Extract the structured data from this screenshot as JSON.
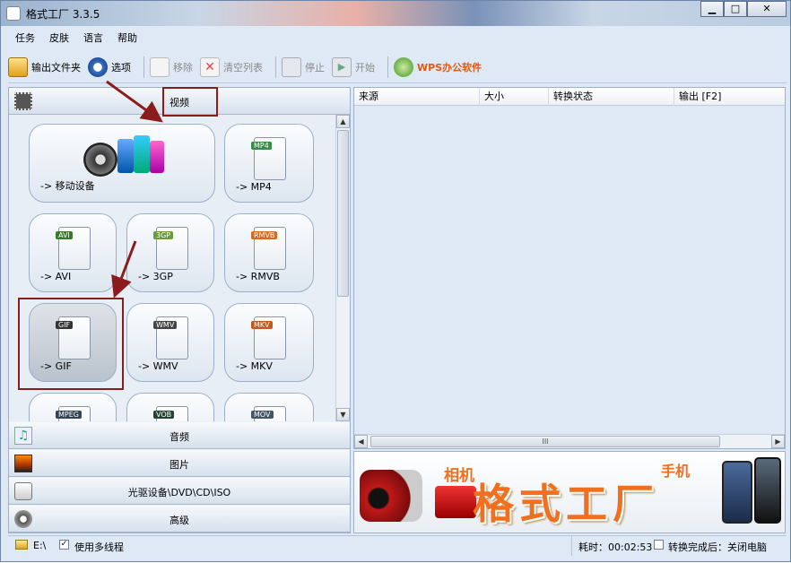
{
  "window": {
    "title": "格式工厂 3.3.5",
    "min_label": "▭",
    "max_label": "□",
    "close_label": "✕"
  },
  "menu": [
    "任务",
    "皮肤",
    "语言",
    "帮助"
  ],
  "toolbar": {
    "output_folder": "输出文件夹",
    "options": "选项",
    "remove": "移除",
    "clear_list": "清空列表",
    "stop": "停止",
    "start": "开始",
    "wps": "WPS办公软件"
  },
  "categories": {
    "video": "视频",
    "audio": "音频",
    "picture": "图片",
    "rom": "光驱设备\\DVD\\CD\\ISO",
    "advanced": "高级"
  },
  "tiles": [
    {
      "label": "-> 移动设备"
    },
    {
      "label": "-> MP4",
      "tag": "MP4"
    },
    {
      "label": "-> AVI",
      "tag": "AVI"
    },
    {
      "label": "-> 3GP",
      "tag": "3GP"
    },
    {
      "label": "-> RMVB",
      "tag": "RMVB"
    },
    {
      "label": "-> GIF",
      "tag": "GIF"
    },
    {
      "label": "-> WMV",
      "tag": "WMV"
    },
    {
      "label": "-> MKV",
      "tag": "MKV"
    },
    {
      "tag": "MPEG"
    },
    {
      "tag": "VOB"
    },
    {
      "tag": "MOV"
    }
  ],
  "list": {
    "columns": [
      "来源",
      "大小",
      "转换状态",
      "输出 [F2]"
    ]
  },
  "hscroll": {
    "grip": "III"
  },
  "banner": {
    "camera_text": "相机",
    "phone_text": "手机",
    "brand_text": "格式工厂"
  },
  "status": {
    "drive": "E:\\",
    "multithread_label": "使用多线程",
    "multithread_checked": true,
    "elapsed": "耗时：00:02:53",
    "shutdown_label": "转换完成后：关闭电脑",
    "shutdown_checked": false
  },
  "colors": {
    "accent_red": "#8b1c1c",
    "wps_orange": "#e05a10",
    "banner_orange": "#f07020"
  }
}
